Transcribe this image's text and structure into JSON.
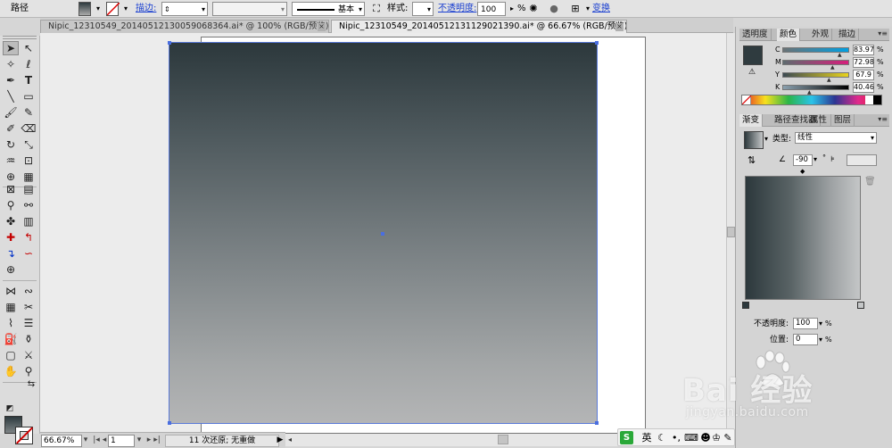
{
  "topbar": {
    "object_type": "路径",
    "stroke_link": "描边:",
    "stroke_width": "",
    "stroke_profile": "",
    "brush_label": "基本",
    "style_label": "样式:",
    "opacity_link": "不透明度:",
    "opacity_value": "100",
    "opacity_unit": "%",
    "transform_link": "变换"
  },
  "doc_tabs": [
    {
      "label": "Nipic_12310549_20140512130059068364.ai* @ 100% (RGB/预览)",
      "close": "×"
    },
    {
      "label": "Nipic_12310549_20140512131129021390.ai* @ 66.67% (RGB/预览)",
      "close": "×"
    }
  ],
  "status": {
    "zoom": "66.67%",
    "page": "1",
    "undo_text": "11 次还原; 无重做"
  },
  "color_panel": {
    "tabs": [
      "透明度",
      "颜色",
      "外观",
      "描边"
    ],
    "active_tab": "颜色",
    "swatch_color": "#2f3b3f",
    "channels": [
      {
        "label": "C",
        "value": "83.97",
        "gradient": "linear-gradient(90deg,#6b7275,#00a0e3)"
      },
      {
        "label": "M",
        "value": "72.98",
        "gradient": "linear-gradient(90deg,#5e6b6f,#d61f7c)"
      },
      {
        "label": "Y",
        "value": "67.9",
        "gradient": "linear-gradient(90deg,#3c4a52,#e8d31d)"
      },
      {
        "label": "K",
        "value": "40.46",
        "gradient": "linear-gradient(90deg,#8aa0ae,#000000)"
      }
    ],
    "unit": "%"
  },
  "gradient_panel": {
    "tabs": [
      "渐变",
      "路径查找器",
      "属性",
      "图层"
    ],
    "active_tab": "渐变",
    "type_label": "类型:",
    "type_value": "线性",
    "angle_value": "-90",
    "angle_unit": "°",
    "opacity_label": "不透明度:",
    "opacity_value": "100",
    "location_label": "位置:",
    "location_value": "0",
    "unit": "%",
    "gradient_start": "#2c383c",
    "gradient_end": "#c4c6c7"
  },
  "watermark": {
    "brand": "Bai  经验",
    "url": "jingyan.baidu.com"
  },
  "ime": {
    "logo": "S",
    "lang": "英",
    "icons": [
      "moon-icon",
      "punctuation-icon",
      "keyboard-icon",
      "user-icon",
      "shirt-icon",
      "wrench-icon"
    ]
  }
}
